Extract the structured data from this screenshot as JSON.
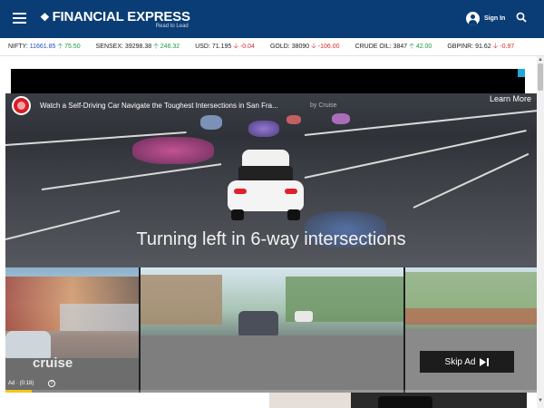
{
  "header": {
    "logo_title": "FINANCIAL EXPRESS",
    "logo_tagline": "Read to Lead",
    "signin_label": "Sign In",
    "icons": {
      "menu": "hamburger-menu-icon",
      "user": "user-icon",
      "search": "search-icon"
    },
    "colors": {
      "background": "#0a3d75"
    }
  },
  "ticker": [
    {
      "name": "NIFTY:",
      "value": "11661.85",
      "change": "75.50",
      "direction": "up"
    },
    {
      "name": "SENSEX:",
      "value": "39298.38",
      "change": "246.32",
      "direction": "up"
    },
    {
      "name": "USD:",
      "value": "71.195",
      "change": "-0.04",
      "direction": "down"
    },
    {
      "name": "GOLD:",
      "value": "38090",
      "change": "-106.00",
      "direction": "down"
    },
    {
      "name": "CRUDE OIL:",
      "value": "3847",
      "change": "42.00",
      "direction": "up"
    },
    {
      "name": "GBPINR:",
      "value": "91.62",
      "change": "-0.97",
      "direction": "down"
    }
  ],
  "ticker_colors": {
    "up": "#1c9b3c",
    "down": "#e12929",
    "nifty_value": "#1e4fbf"
  },
  "video_ad": {
    "title": "Watch a Self-Driving Car Navigate the Toughest Intersections in San Fra...",
    "channel": "by Cruise",
    "learn_more": "Learn More",
    "caption": "Turning left in 6-way intersections",
    "watermark": "cruise",
    "ad_time": "Ad · (0:18)",
    "skip_label": "Skip Ad",
    "progress_fraction": 0.05,
    "progress_color": "#f5c51e"
  }
}
